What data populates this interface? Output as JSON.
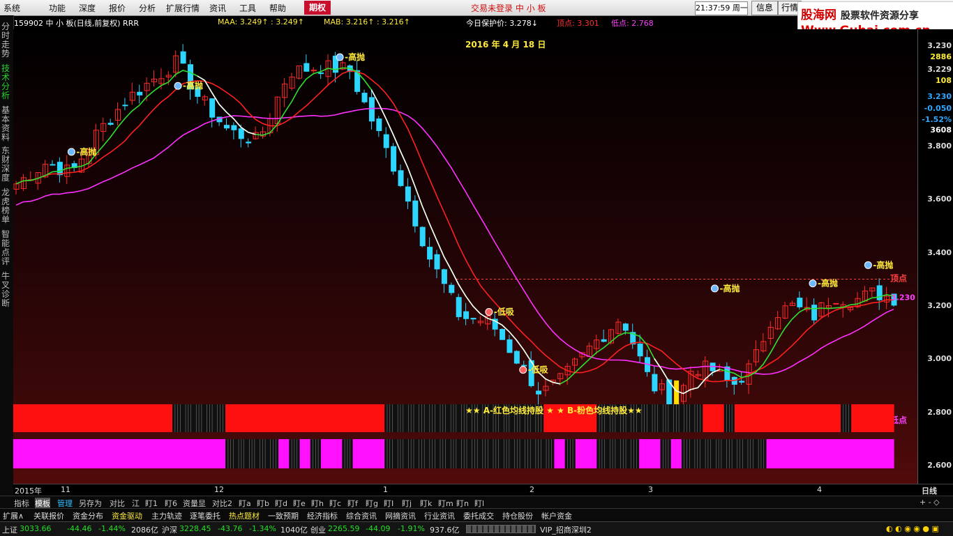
{
  "menu": [
    "系统",
    "功能",
    "深度",
    "报价",
    "分析",
    "扩展行情",
    "资讯",
    "工具",
    "帮助"
  ],
  "tab_options": "期权",
  "login_status": "交易未登录  中 小 板",
  "clock": "21:37:59 周一",
  "header_buttons": [
    "信息",
    "行情"
  ],
  "watermark": {
    "brand_a": "股海网",
    "brand_b": "股票软件资源分享",
    "url": "Www.Guhai.com.cn"
  },
  "left_rail": [
    {
      "label": "分时走势",
      "active": false
    },
    {
      "label": "技术分析",
      "active": true
    },
    {
      "label": "基本资料",
      "active": false
    },
    {
      "label": "东财深度",
      "active": false
    },
    {
      "label": "龙虎榜单",
      "active": false
    },
    {
      "label": "智能点评",
      "active": false
    },
    {
      "label": "牛叉诊断",
      "active": false
    }
  ],
  "title_bar": {
    "code_name": "159902 中 小 板(日线,前复权) RRR",
    "maa": "MAA: 3.249↑ : 3.249↑",
    "mab": "MAB: 3.216↑ : 3.216↑",
    "protect": "今日保护价: 3.278↓",
    "top": "顶点: 3.301",
    "bottom": "低点: 2.768"
  },
  "chart_data": {
    "type": "candlestick",
    "symbol": "159902",
    "date_label": "2016 年 4 月 18 日",
    "y_ticks": [
      "3.800",
      "3.600",
      "3.400",
      "3.200",
      "3.000",
      "2.800",
      "2.600"
    ],
    "y_range": [
      2.55,
      4.22
    ],
    "quote_panel": [
      "3.230",
      "2886",
      "3.229",
      "108",
      "3.230",
      "-0.050",
      "-1.52%",
      "3608"
    ],
    "x_ticks": [
      "2015年",
      "11",
      "12",
      "1",
      "2",
      "3",
      "4"
    ],
    "ref_lines": {
      "top": {
        "value": 3.301,
        "label": "顶点"
      },
      "bottom": {
        "value": 2.768,
        "label": "低点"
      }
    },
    "last_price_label": "3.230",
    "signals": [
      {
        "label": "高抛",
        "date": "2015-10-08",
        "y": 3.78
      },
      {
        "label": "高抛",
        "date": "2015-11-02",
        "y": 4.028
      },
      {
        "label": "高抛",
        "date": "2015-12-10",
        "y": 4.136
      },
      {
        "label": "低吸",
        "date": "2016-01-14",
        "y": 3.178
      },
      {
        "label": "低吸",
        "date": "2016-01-22",
        "y": 2.96
      },
      {
        "label": "高抛",
        "date": "2016-03-07",
        "y": 3.266
      },
      {
        "label": "高抛",
        "date": "2016-03-30",
        "y": 3.285
      },
      {
        "label": "高抛",
        "date": "2016-04-12",
        "y": 3.354
      }
    ],
    "legend_band_text": "★★ A-红色均线持股 ★ ★ B-粉色均线持股★★",
    "band_a": {
      "color": "#ff1010",
      "pattern": [
        1,
        1,
        1,
        1,
        1,
        1,
        1,
        1,
        1,
        1,
        1,
        1,
        1,
        1,
        1,
        0,
        0,
        0,
        0,
        0,
        1,
        1,
        1,
        1,
        1,
        1,
        1,
        1,
        1,
        1,
        1,
        1,
        1,
        1,
        1,
        0,
        0,
        0,
        0,
        0,
        0,
        0,
        0,
        0,
        0,
        0,
        0,
        0,
        0,
        0,
        1,
        1,
        1,
        1,
        1,
        0,
        0,
        0,
        0,
        0,
        0,
        0,
        0,
        0,
        0,
        1,
        1,
        0,
        1,
        1,
        1,
        1,
        1,
        1,
        1,
        1,
        1,
        1,
        0,
        1,
        1,
        1,
        1
      ]
    },
    "band_b": {
      "color": "#ff10ff",
      "pattern": [
        1,
        1,
        1,
        1,
        1,
        1,
        1,
        1,
        1,
        1,
        1,
        1,
        1,
        1,
        1,
        1,
        1,
        1,
        1,
        1,
        0,
        0,
        0,
        0,
        0,
        1,
        0,
        1,
        0,
        1,
        1,
        0,
        1,
        1,
        1,
        0,
        0,
        0,
        0,
        0,
        0,
        0,
        0,
        0,
        0,
        0,
        0,
        0,
        0,
        0,
        0,
        1,
        0,
        1,
        1,
        0,
        0,
        0,
        0,
        1,
        1,
        0,
        1,
        0,
        0,
        0,
        0,
        0,
        0,
        0,
        0,
        1,
        1,
        1,
        1,
        1,
        1,
        1,
        1,
        1,
        1,
        1,
        1
      ]
    }
  },
  "indicator_tabs": [
    "指标",
    "模板",
    "管理",
    "另存为",
    "对比",
    "江",
    "盯1",
    "盯6",
    "资量显",
    "对比2",
    "盯a",
    "盯b",
    "盯d",
    "盯e",
    "盯h",
    "盯c",
    "盯f",
    "盯g",
    "盯I",
    "盯j",
    "盯k",
    "盯m",
    "盯n",
    "盯l"
  ],
  "func_bar": [
    "扩展∧",
    "关联报价",
    "资金分布",
    "资金驱动",
    "主力轨迹",
    "逐笔委托",
    "热点题材",
    "一致预期",
    "经济指标",
    "综合资讯",
    "网摘资讯",
    "行业资讯",
    "委托成交",
    "持仓股份",
    "帐户资金"
  ],
  "status_bar": {
    "sh_name": "上证",
    "sh_value": "3033.66",
    "sh_change": "-44.46",
    "sh_pct": "-1.44%",
    "sh_amount": "2086亿",
    "sz_name": "沪深",
    "sz_value": "3228.45",
    "sz_change": "-43.76",
    "sz_pct": "-1.34%",
    "sz_amount": "1040亿",
    "cy_name": "创业",
    "cy_value": "2265.59",
    "cy_change": "-44.09",
    "cy_pct": "-1.91%",
    "cy_amount": "937.6亿",
    "vip": "VIP_招商深圳2"
  },
  "right_controls": {
    "period": "日线",
    "zoom": "+ - ◇"
  }
}
